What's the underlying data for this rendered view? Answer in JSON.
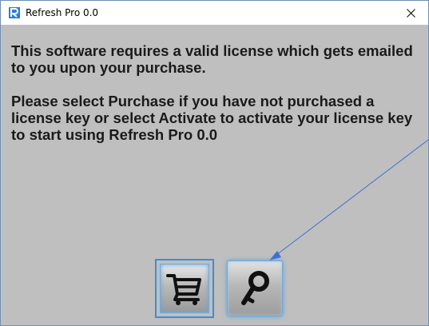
{
  "window": {
    "title": "Refresh Pro 0.0",
    "close_label": "×"
  },
  "message": {
    "paragraph1": "This software requires a valid license which gets emailed to you upon your purchase.",
    "paragraph2": "Please select Purchase if you have not purchased a license key or select Activate to activate your license key to start using Refresh Pro 0.0"
  },
  "buttons": {
    "purchase_icon": "cart-icon",
    "activate_icon": "key-icon"
  },
  "colors": {
    "dialog_background": "#bfbfbf",
    "accent_blue": "#3a8fd6",
    "arrow": "#3e6fd0"
  }
}
